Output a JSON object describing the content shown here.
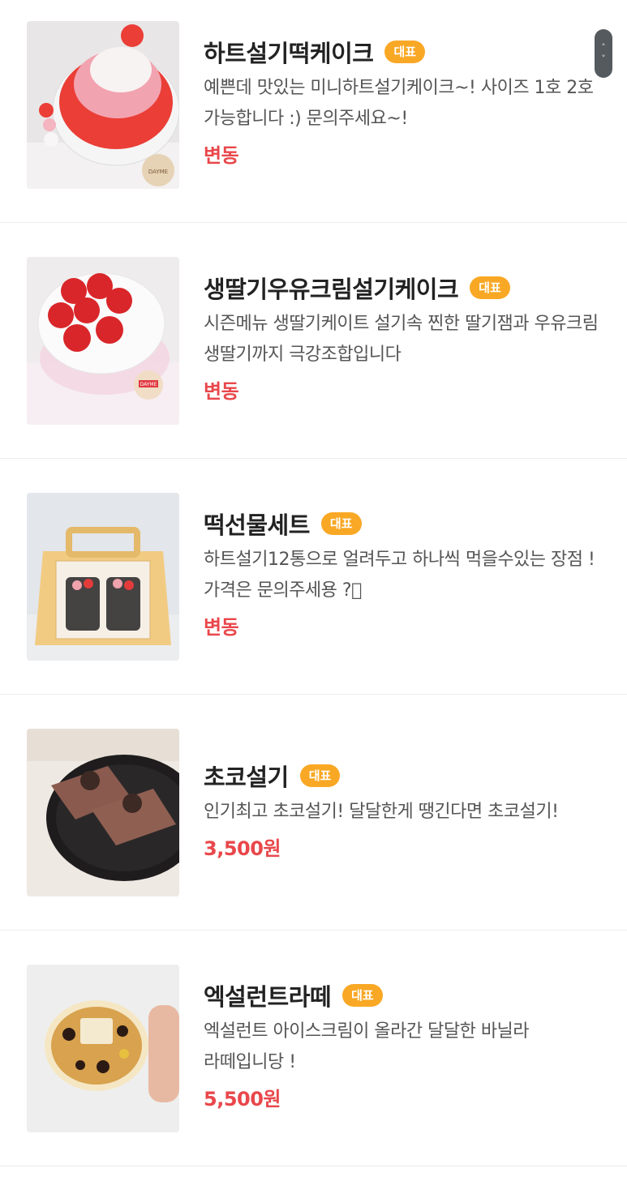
{
  "menu": {
    "badge_label": "대표",
    "items": [
      {
        "title": "하트설기떡케이크",
        "description": "예쁜데 맛있는 미니하트설기케이크~! 사이즈 1호 2호 가능합니다 :) 문의주세요~!",
        "price": "변동",
        "image": "heart-rice-cake-photo"
      },
      {
        "title": "생딸기우유크림설기케이크",
        "description": "시즌메뉴 생딸기케이트 설기속 찐한 딸기잼과 우유크림 생딸기까지 극강조합입니다",
        "price": "변동",
        "image": "strawberry-cake-photo"
      },
      {
        "title": "떡선물세트",
        "description": "하트설기12통으로 얼려두고 하나씩 먹을수있는 장점 ! 가격은 문의주세용 ?􏰀",
        "price": "변동",
        "image": "gift-box-photo"
      },
      {
        "title": "초코설기",
        "description": "인기최고 초코설기! 달달한게 땡긴다면 초코설기!",
        "price": "3,500원",
        "image": "choco-seolgi-photo"
      },
      {
        "title": "엑설런트라떼",
        "description": "엑설런트 아이스크림이 올라간 달달한 바닐라 라떼입니당 !",
        "price": "5,500원",
        "image": "latte-photo"
      }
    ]
  },
  "scroll": {
    "up_glyph": "˄",
    "down_glyph": "˅"
  }
}
